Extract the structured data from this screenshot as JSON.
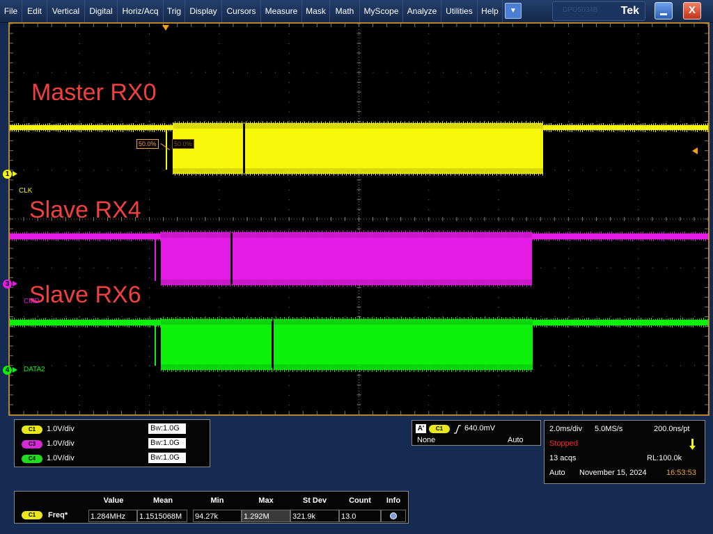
{
  "menu": [
    "File",
    "Edit",
    "Vertical",
    "Digital",
    "Horiz/Acq",
    "Trig",
    "Display",
    "Cursors",
    "Measure",
    "Mask",
    "Math",
    "MyScope",
    "Analyze",
    "Utilities",
    "Help"
  ],
  "title_text": "DPO5034B",
  "brand": "Tek",
  "close_glyph": "X",
  "dropdown_glyph": "▼",
  "annotations": [
    "Master RX0",
    "Slave RX4",
    "Slave RX6"
  ],
  "channels": [
    {
      "id": "1",
      "name": "CLK",
      "color": "#f7f70a"
    },
    {
      "id": "3",
      "name": "CMD",
      "color": "#e41be4"
    },
    {
      "id": "4",
      "name": "DATA2",
      "color": "#0cf00c"
    }
  ],
  "measure_markers": [
    "50.0%",
    "50.0%"
  ],
  "vertical": [
    {
      "ch": "C1",
      "scale": "1.0V/div",
      "bw": "1.0G",
      "color": "#e8e81a"
    },
    {
      "ch": "C3",
      "scale": "1.0V/div",
      "bw": "1.0G",
      "color": "#d42cd4"
    },
    {
      "ch": "C4",
      "scale": "1.0V/div",
      "bw": "1.0G",
      "color": "#1fdc1f"
    }
  ],
  "trigger": {
    "label": "A'",
    "source": "C1",
    "level": "640.0mV",
    "coupling": "None",
    "mode": "Auto"
  },
  "acquisition": {
    "timebase": "2.0ms/div",
    "sample_rate": "5.0MS/s",
    "resolution": "200.0ns/pt",
    "state": "Stopped",
    "acqs": "13 acqs",
    "record_length": "RL:100.0k",
    "mode": "Auto",
    "date": "November 15, 2024",
    "time": "16:53:53"
  },
  "measurements": {
    "headers": [
      "Value",
      "Mean",
      "Min",
      "Max",
      "St Dev",
      "Count",
      "Info"
    ],
    "rows": [
      {
        "ch": "C1",
        "name": "Freq*",
        "value": "1.284MHz",
        "mean": "1.1515068M",
        "min": "94.27k",
        "max": "1.292M",
        "stdev": "321.9k",
        "count": "13.0"
      }
    ]
  },
  "colors": {
    "graticule": "#7a7a7a",
    "frame": "#b8852c",
    "annotation": "#f2403f",
    "stopped": "#ff2a2a",
    "time": "#f4a53c",
    "trigger_marker": "#f29f1b"
  }
}
